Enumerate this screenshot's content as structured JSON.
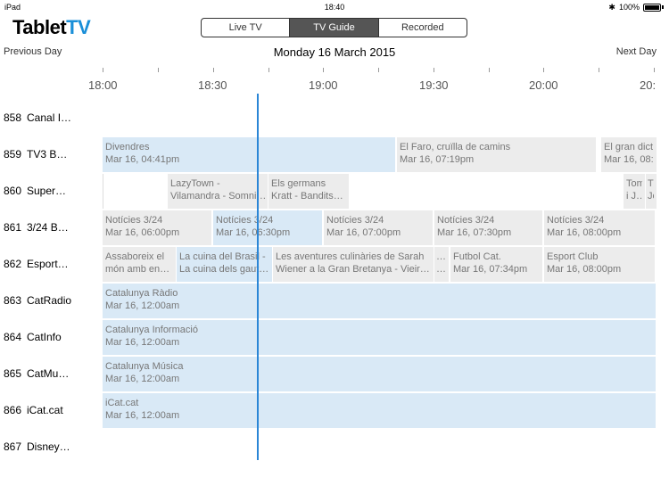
{
  "status_bar": {
    "device": "iPad",
    "time": "18:40",
    "battery": "100%"
  },
  "app": {
    "logo_main": "Tablet",
    "logo_accent": "TV"
  },
  "tabs": [
    {
      "label": "Live TV",
      "active": false
    },
    {
      "label": "TV Guide",
      "active": true
    },
    {
      "label": "Recorded",
      "active": false
    }
  ],
  "day_nav": {
    "previous": "Previous Day",
    "next": "Next Day",
    "date": "Monday 16 March 2015"
  },
  "timeline": [
    "18:00",
    "18:30",
    "19:00",
    "19:30",
    "20:00",
    "20:"
  ],
  "channels": [
    {
      "num": "858",
      "name": "Canal I…"
    },
    {
      "num": "859",
      "name": "TV3 B…"
    },
    {
      "num": "860",
      "name": "Super…"
    },
    {
      "num": "861",
      "name": "3/24 B…"
    },
    {
      "num": "862",
      "name": "Esport…"
    },
    {
      "num": "863",
      "name": "CatRadio"
    },
    {
      "num": "864",
      "name": "CatInfo"
    },
    {
      "num": "865",
      "name": "CatMu…"
    },
    {
      "num": "866",
      "name": "iCat.cat"
    },
    {
      "num": "867",
      "name": "Disney…"
    }
  ],
  "programs": {
    "r859": [
      {
        "title": "Divendres",
        "time": "Mar 16, 04:41pm"
      },
      {
        "title": "El Faro, cruïlla de camins",
        "time": "Mar 16, 07:19pm"
      },
      {
        "title": "El gran dict",
        "time": "Mar 16, 08:"
      }
    ],
    "r860": [
      {
        "title": "LazyTown -",
        "time": "Vilamandra - Somni…"
      },
      {
        "title": "Els germans",
        "time": "Kratt - Bandits…"
      },
      {
        "title": "Tom",
        "time": "i J…"
      },
      {
        "title": "T",
        "time": "Je"
      }
    ],
    "r861": [
      {
        "title": "Notícies 3/24",
        "time": "Mar 16, 06:00pm"
      },
      {
        "title": "Notícies 3/24",
        "time": "Mar 16, 06:30pm"
      },
      {
        "title": "Notícies 3/24",
        "time": "Mar 16, 07:00pm"
      },
      {
        "title": "Notícies 3/24",
        "time": "Mar 16, 07:30pm"
      },
      {
        "title": "Notícies 3/24",
        "time": "Mar 16, 08:00pm"
      }
    ],
    "r862": [
      {
        "title": "Assaboreix el",
        "time": "món amb en…"
      },
      {
        "title": "La cuina del Brasil -",
        "time": "La cuina dels gaut…"
      },
      {
        "title": "Les aventures culinàries de Sarah",
        "time": "Wiener a la Gran Bretanya - Vieir…"
      },
      {
        "title": "…",
        "time": "…"
      },
      {
        "title": "Futbol Cat.",
        "time": "Mar 16, 07:34pm"
      },
      {
        "title": "Esport Club",
        "time": "Mar 16, 08:00pm"
      }
    ],
    "r863": [
      {
        "title": "Catalunya Ràdio",
        "time": "Mar 16, 12:00am"
      }
    ],
    "r864": [
      {
        "title": "Catalunya Informació",
        "time": "Mar 16, 12:00am"
      }
    ],
    "r865": [
      {
        "title": "Catalunya Música",
        "time": "Mar 16, 12:00am"
      }
    ],
    "r866": [
      {
        "title": "iCat.cat",
        "time": "Mar 16, 12:00am"
      }
    ]
  }
}
